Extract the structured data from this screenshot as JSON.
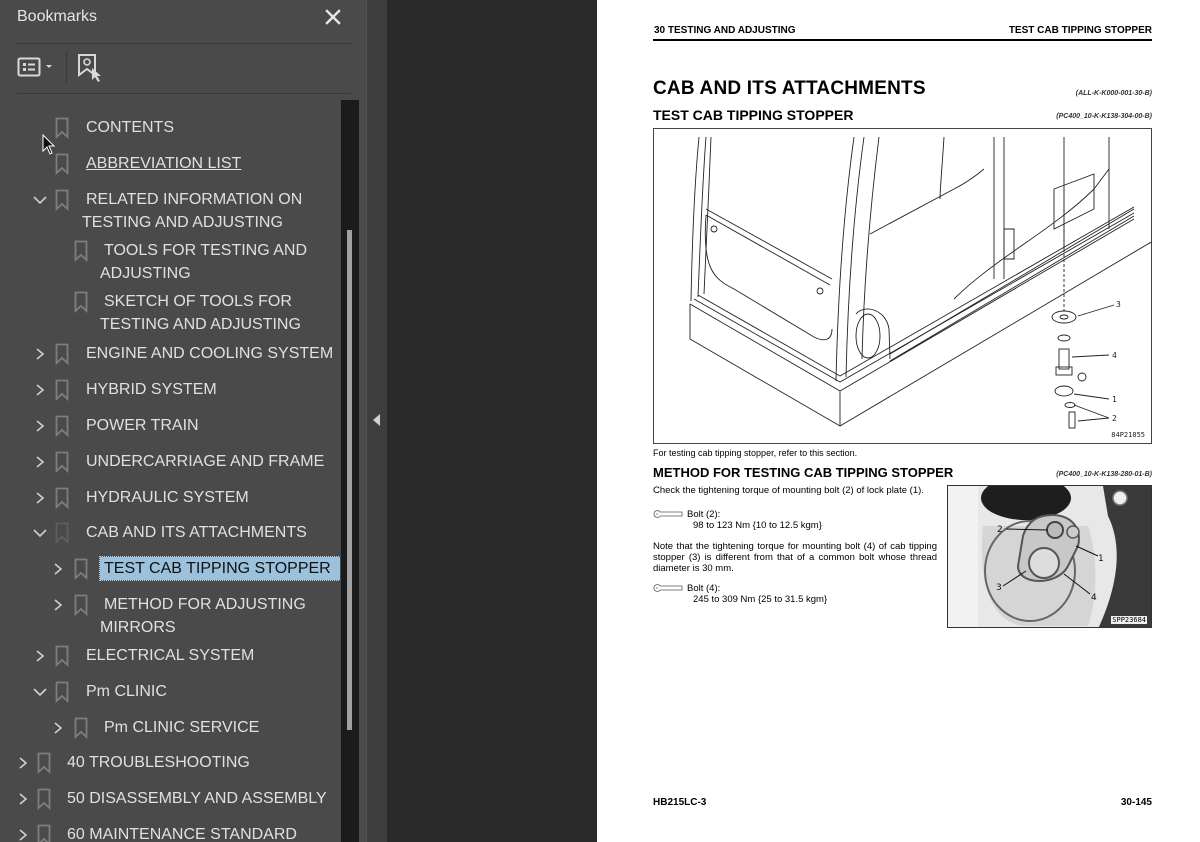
{
  "panel": {
    "title": "Bookmarks",
    "close_icon": "close-icon",
    "toolbar": {
      "options_icon": "bookmark-options-icon",
      "find_icon": "find-current-bookmark-icon"
    },
    "items": [
      {
        "label": "CONTENTS",
        "level": 1,
        "expand": "none",
        "underline": false,
        "selected": false
      },
      {
        "label": "ABBREVIATION LIST",
        "level": 1,
        "expand": "none",
        "underline": true,
        "selected": false
      },
      {
        "label": "RELATED INFORMATION ON\nTESTING AND ADJUSTING",
        "level": 1,
        "expand": "expanded",
        "underline": false,
        "selected": false
      },
      {
        "label": "TOOLS FOR TESTING AND\nADJUSTING",
        "level": 2,
        "expand": "none",
        "underline": false,
        "selected": false
      },
      {
        "label": "SKETCH OF TOOLS FOR\nTESTING AND ADJUSTING",
        "level": 2,
        "expand": "none",
        "underline": false,
        "selected": false
      },
      {
        "label": "ENGINE AND COOLING SYSTEM",
        "level": 1,
        "expand": "collapsed",
        "underline": false,
        "selected": false
      },
      {
        "label": "HYBRID SYSTEM",
        "level": 1,
        "expand": "collapsed",
        "underline": false,
        "selected": false
      },
      {
        "label": "POWER TRAIN",
        "level": 1,
        "expand": "collapsed",
        "underline": false,
        "selected": false
      },
      {
        "label": "UNDERCARRIAGE AND FRAME",
        "level": 1,
        "expand": "collapsed",
        "underline": false,
        "selected": false
      },
      {
        "label": "HYDRAULIC SYSTEM",
        "level": 1,
        "expand": "collapsed",
        "underline": false,
        "selected": false
      },
      {
        "label": "CAB AND ITS ATTACHMENTS",
        "level": 1,
        "expand": "expanded",
        "underline": false,
        "selected": false
      },
      {
        "label": "TEST CAB TIPPING STOPPER",
        "level": 2,
        "expand": "collapsed",
        "underline": false,
        "selected": true
      },
      {
        "label": "METHOD FOR ADJUSTING\nMIRRORS",
        "level": 2,
        "expand": "collapsed",
        "underline": false,
        "selected": false
      },
      {
        "label": "ELECTRICAL SYSTEM",
        "level": 1,
        "expand": "collapsed",
        "underline": false,
        "selected": false
      },
      {
        "label": "Pm CLINIC",
        "level": 1,
        "expand": "expanded",
        "underline": false,
        "selected": false
      },
      {
        "label": "Pm CLINIC SERVICE",
        "level": 2,
        "expand": "collapsed",
        "underline": false,
        "selected": false
      },
      {
        "label": "40 TROUBLESHOOTING",
        "level": 0,
        "expand": "collapsed",
        "underline": false,
        "selected": false
      },
      {
        "label": "50 DISASSEMBLY AND ASSEMBLY",
        "level": 0,
        "expand": "collapsed",
        "underline": false,
        "selected": false
      },
      {
        "label": "60 MAINTENANCE STANDARD",
        "level": 0,
        "expand": "collapsed",
        "underline": false,
        "selected": false
      }
    ]
  },
  "colors": {
    "panel_bg": "#4a4a4a",
    "workspace_bg": "#2a2a2a",
    "selection_bg": "#9bc1dc",
    "text": "#e0e0e0"
  },
  "document": {
    "header_left": "30 TESTING AND ADJUSTING",
    "header_right": "TEST CAB TIPPING STOPPER",
    "title": "CAB AND ITS ATTACHMENTS",
    "title_code": "(ALL-K-K000-001-30-B)",
    "section_title": "TEST CAB TIPPING STOPPER",
    "section_code": "(PC400_10-K-K138-304-00-B)",
    "figure1_id": "84P21855",
    "figure1_callouts": [
      "3",
      "4",
      "1",
      "2"
    ],
    "caption": "For testing cab tipping stopper, refer to this section.",
    "method_title": "METHOD FOR TESTING CAB TIPPING STOPPER",
    "method_code": "(PC400_10-K-K138-280-01-B)",
    "para1": "Check the tightening torque of mounting bolt (2) of lock plate (1).",
    "torque1_label": "Bolt (2):",
    "torque1_value": "98 to 123 Nm {10 to 12.5 kgm}",
    "para2": "Note that the tightening torque for mounting bolt (4) of cab tipping stopper (3) is different from that of a common bolt whose thread diameter is 30 mm.",
    "torque2_label": "Bolt (4):",
    "torque2_value": "245 to 309 Nm {25 to 31.5 kgm}",
    "photo_id": "SPP23684",
    "photo_callouts": [
      "2",
      "1",
      "3",
      "4"
    ],
    "footer_left": "HB215LC-3",
    "footer_right": "30-145"
  }
}
